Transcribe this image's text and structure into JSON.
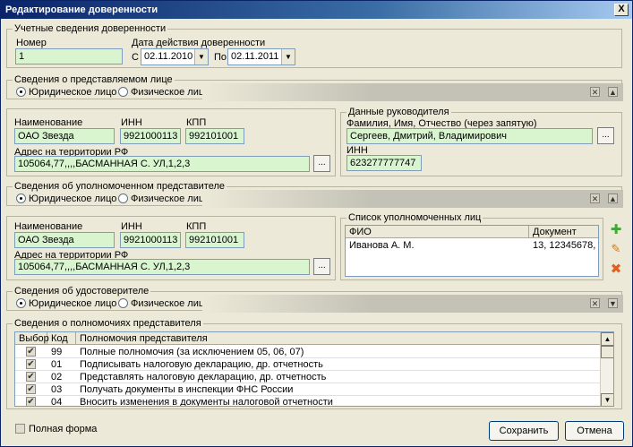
{
  "window": {
    "title": "Редактирование доверенности",
    "close_label": "X"
  },
  "accounting": {
    "legend": "Учетные сведения доверенности",
    "number_label": "Номер",
    "number_value": "1",
    "validity_label": "Дата действия доверенности",
    "from_label": "С",
    "from_date": "02.11.2010",
    "to_label": "По",
    "to_date": "02.11.2011"
  },
  "represented": {
    "legend": "Сведения о представляемом лице",
    "radio_legal": "Юридическое лицо",
    "radio_physical": "Физическое лицо",
    "name_label": "Наименование",
    "name_value": "ОАО Звезда",
    "inn_label": "ИНН",
    "inn_value": "9921000113",
    "kpp_label": "КПП",
    "kpp_value": "992101001",
    "address_label": "Адрес на территории РФ",
    "address_value": "105064,77,,,,БАСМАННАЯ С. УЛ,1,2,3",
    "dots_label": "..."
  },
  "head": {
    "legend": "Данные руководителя",
    "fio_label": "Фамилия, Имя, Отчество (через запятую)",
    "fio_value": "Сергеев, Дмитрий, Владимирович",
    "inn_label": "ИНН",
    "inn_value": "623277777747",
    "dots_label": "..."
  },
  "authorized": {
    "legend": "Сведения об уполномоченном представителе",
    "radio_legal": "Юридическое лицо",
    "radio_physical": "Физическое лицо",
    "name_label": "Наименование",
    "name_value": "ОАО Звезда",
    "inn_label": "ИНН",
    "inn_value": "9921000113",
    "kpp_label": "КПП",
    "kpp_value": "992101001",
    "address_label": "Адрес на территории РФ",
    "address_value": "105064,77,,,,БАСМАННАЯ С. УЛ,1,2,3",
    "dots_label": "..."
  },
  "persons": {
    "legend": "Список уполномоченных лиц",
    "col_fio": "ФИО",
    "col_doc": "Документ",
    "rows": [
      {
        "fio": "Иванова А. М.",
        "doc": "13, 12345678,"
      }
    ]
  },
  "certifier": {
    "legend": "Сведения об удостоверителе",
    "radio_legal": "Юридическое лицо",
    "radio_physical": "Физическое лицо"
  },
  "powers": {
    "legend": "Сведения о полномочиях представителя",
    "col_select": "Выбор",
    "col_code": "Код",
    "col_desc": "Полномочия представителя",
    "rows": [
      {
        "code": "99",
        "desc": "Полные полномочия (за исключением 05, 06, 07)",
        "checked": true
      },
      {
        "code": "01",
        "desc": "Подписывать налоговую декларацию, др. отчетность",
        "checked": true
      },
      {
        "code": "02",
        "desc": "Представлять налоговую декларацию, др. отчетность",
        "checked": true
      },
      {
        "code": "03",
        "desc": "Получать документы в инспекции ФНС России",
        "checked": true
      },
      {
        "code": "04",
        "desc": "Вносить изменения в документы налоговой отчетности",
        "checked": true
      }
    ]
  },
  "footer": {
    "full_form_label": "Полная форма",
    "save_label": "Сохранить",
    "cancel_label": "Отмена"
  }
}
